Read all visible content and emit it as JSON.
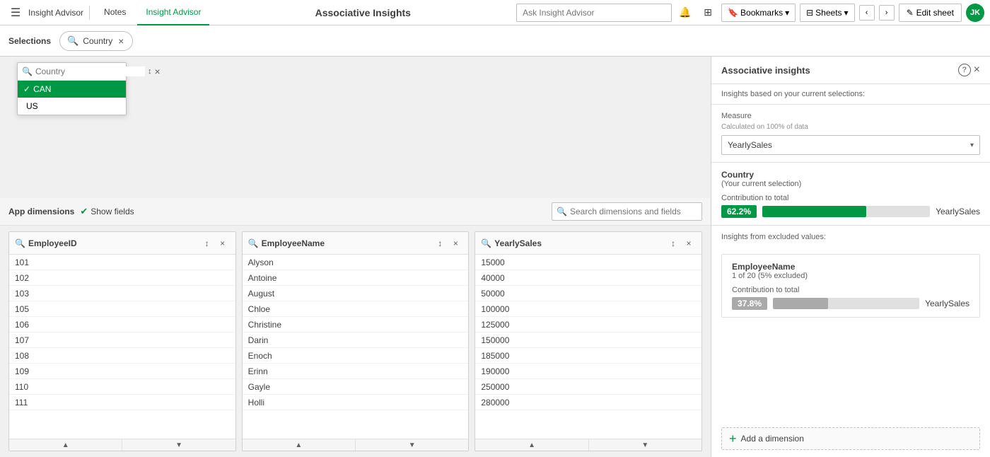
{
  "toolbar": {
    "menu_icon": "☰",
    "app_name": "Insight Advisor",
    "tabs": [
      "Notes",
      "Insight Advisor"
    ],
    "active_tab": "Insight Advisor",
    "app_title": "Associative Insights",
    "ask_insight_placeholder": "Ask Insight Advisor",
    "bookmarks_label": "Bookmarks",
    "sheets_label": "Sheets",
    "edit_sheet_label": "Edit sheet",
    "nav_prev": "‹",
    "nav_next": "›",
    "avatar_initials": "JK"
  },
  "selections_bar": {
    "label": "Selections",
    "pills": [
      {
        "id": "country",
        "label": "Country",
        "has_clear": true
      }
    ]
  },
  "country_dropdown": {
    "search_placeholder": "Country",
    "items": [
      {
        "value": "CAN",
        "selected": true
      },
      {
        "value": "US",
        "selected": false
      }
    ]
  },
  "app_dimensions": {
    "label": "App dimensions",
    "show_fields_label": "Show fields",
    "show_fields_checked": true,
    "search_placeholder": "Search dimensions and fields",
    "columns": [
      {
        "id": "employeeid",
        "title": "EmployeeID",
        "items": [
          {
            "value": "101"
          },
          {
            "value": "102"
          },
          {
            "value": "103"
          },
          {
            "value": "105"
          },
          {
            "value": "106"
          },
          {
            "value": "107"
          },
          {
            "value": "108"
          },
          {
            "value": "109"
          },
          {
            "value": "110"
          },
          {
            "value": "111"
          }
        ]
      },
      {
        "id": "employeename",
        "title": "EmployeeName",
        "items": [
          {
            "value": "Alyson"
          },
          {
            "value": "Antoine"
          },
          {
            "value": "August"
          },
          {
            "value": "Chloe"
          },
          {
            "value": "Christine"
          },
          {
            "value": "Darin"
          },
          {
            "value": "Enoch"
          },
          {
            "value": "Erinn"
          },
          {
            "value": "Gayle"
          },
          {
            "value": "Holli"
          }
        ]
      },
      {
        "id": "yearlysales",
        "title": "YearlySales",
        "items": [
          {
            "value": "15000"
          },
          {
            "value": "40000"
          },
          {
            "value": "50000"
          },
          {
            "value": "100000"
          },
          {
            "value": "125000"
          },
          {
            "value": "150000"
          },
          {
            "value": "185000"
          },
          {
            "value": "190000"
          },
          {
            "value": "250000"
          },
          {
            "value": "280000"
          }
        ]
      }
    ]
  },
  "associative_insights": {
    "title": "Associative insights",
    "subtext": "Insights based on your current selections:",
    "measure_label": "Measure",
    "measure_sublabel": "Calculated on 100% of data",
    "measure_value": "YearlySales",
    "country_section": {
      "title": "Country",
      "subtitle": "(Your current selection)",
      "contribution_label": "Contribution to total",
      "contribution_pct": "62.2%",
      "contribution_field": "YearlySales"
    },
    "excluded_label": "Insights from excluded values:",
    "employee_section": {
      "title": "EmployeeName",
      "subtitle": "1 of 20 (5% excluded)",
      "contribution_label": "Contribution to total",
      "contribution_pct": "37.8%",
      "contribution_field": "YearlySales"
    },
    "add_dimension_label": "Add a dimension"
  }
}
